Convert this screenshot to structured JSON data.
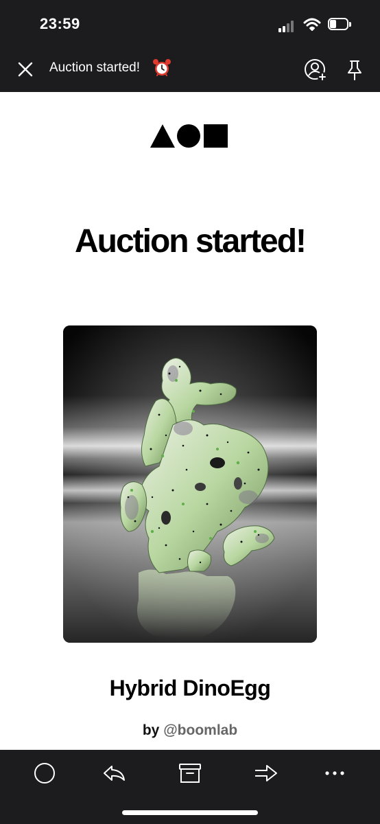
{
  "status_bar": {
    "time": "23:59"
  },
  "navbar": {
    "title": "Auction started!",
    "title_emoji_icon": "alarm-clock-icon",
    "left_icon": "close-icon",
    "right_icons": [
      "user-add-icon",
      "pin-icon"
    ]
  },
  "email": {
    "logo_icon": "triangle-circle-square-logo",
    "headline": "Auction started!",
    "artwork": {
      "title": "Hybrid DinoEgg",
      "by_label": "by",
      "artist_handle": "@boomlab"
    }
  },
  "toolbar": {
    "icons": [
      "circle-icon",
      "reply-icon",
      "archive-icon",
      "forward-icon",
      "more-icon"
    ]
  },
  "colors": {
    "chrome": "#1c1c1e",
    "background": "#ffffff",
    "text": "#000000",
    "handle": "#666666"
  }
}
